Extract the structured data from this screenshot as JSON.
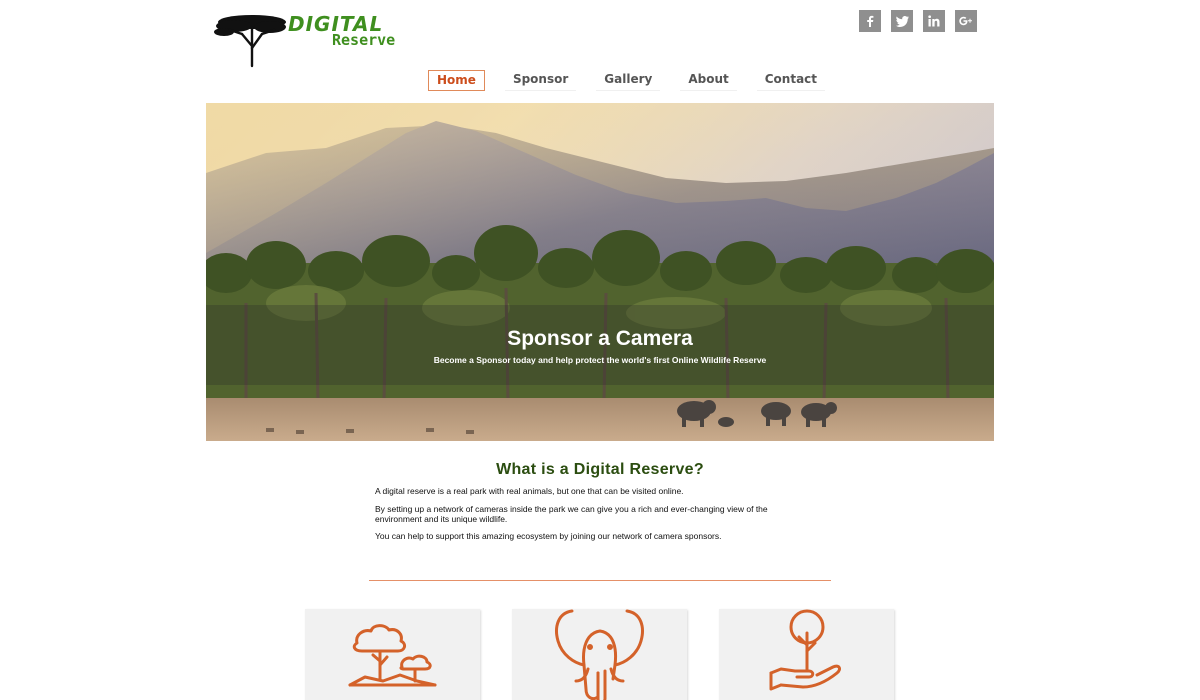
{
  "logo": {
    "word1": "DIGITAL",
    "word2": "Reserve"
  },
  "social": [
    {
      "name": "facebook-icon"
    },
    {
      "name": "twitter-icon"
    },
    {
      "name": "linkedin-icon"
    },
    {
      "name": "google-plus-icon"
    }
  ],
  "nav": {
    "items": [
      {
        "label": "Home",
        "active": true
      },
      {
        "label": "Sponsor"
      },
      {
        "label": "Gallery"
      },
      {
        "label": "About"
      },
      {
        "label": "Contact"
      }
    ]
  },
  "hero": {
    "title": "Sponsor a Camera",
    "subtitle": "Become a Sponsor today and help protect the world's first Online Wildlife Reserve"
  },
  "content": {
    "title": "What is a Digital Reserve?",
    "paragraphs": [
      "A digital reserve is a real park with real animals, but one that can be visited online.",
      "By setting up a network of cameras inside the park we can give you a rich and ever-changing view of the environment and its unique wildlife.",
      "You can help to support this amazing ecosystem by joining our network of camera sponsors."
    ]
  },
  "cards": [
    {
      "icon": "savanna-trees-icon"
    },
    {
      "icon": "elephant-icon"
    },
    {
      "icon": "hand-plant-icon"
    }
  ],
  "colors": {
    "brand_green": "#3f8f1f",
    "accent_orange": "#cc4d1c",
    "heading_green": "#2b4d10"
  }
}
